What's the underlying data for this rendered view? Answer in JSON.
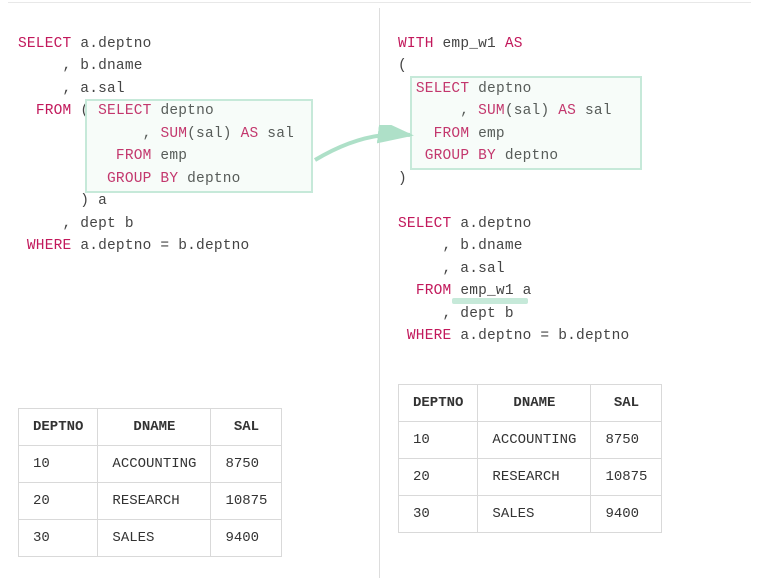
{
  "left": {
    "code": {
      "l1a": "SELECT",
      "l1b": " a.deptno",
      "l2": "     , b.dname",
      "l3": "     , a.sal",
      "l4a": "  ",
      "l4b": "FROM",
      "l4c": " ( ",
      "l4d": "SELECT",
      "l4e": " deptno",
      "l5a": "              , ",
      "l5b": "SUM",
      "l5c": "(sal) ",
      "l5d": "AS",
      "l5e": " sal",
      "l6a": "           ",
      "l6b": "FROM",
      "l6c": " emp",
      "l7a": "          ",
      "l7b": "GROUP BY",
      "l7c": " deptno",
      "l8": "       ) a",
      "l9": "     , dept b",
      "l10a": " ",
      "l10b": "WHERE",
      "l10c": " a.deptno = b.deptno"
    },
    "table": {
      "headers": [
        "DEPTNO",
        "DNAME",
        "SAL"
      ],
      "rows": [
        [
          "10",
          "ACCOUNTING",
          "8750"
        ],
        [
          "20",
          "RESEARCH",
          "10875"
        ],
        [
          "30",
          "SALES",
          "9400"
        ]
      ]
    }
  },
  "right": {
    "code": {
      "l1a": "WITH",
      "l1b": " emp_w1 ",
      "l1c": "AS",
      "l2": "(",
      "l3a": "  ",
      "l3b": "SELECT",
      "l3c": " deptno",
      "l4a": "       , ",
      "l4b": "SUM",
      "l4c": "(sal) ",
      "l4d": "AS",
      "l4e": " sal",
      "l5a": "    ",
      "l5b": "FROM",
      "l5c": " emp",
      "l6a": "   ",
      "l6b": "GROUP BY",
      "l6c": " deptno",
      "l7": ")",
      "l8": "",
      "l9a": "SELECT",
      "l9b": " a.deptno",
      "l10": "     , b.dname",
      "l11": "     , a.sal",
      "l12a": "  ",
      "l12b": "FROM",
      "l12c": " emp_w1 a",
      "l13": "     , dept b",
      "l14a": " ",
      "l14b": "WHERE",
      "l14c": " a.deptno = b.deptno"
    },
    "table": {
      "headers": [
        "DEPTNO",
        "DNAME",
        "SAL"
      ],
      "rows": [
        [
          "10",
          "ACCOUNTING",
          "8750"
        ],
        [
          "20",
          "RESEARCH",
          "10875"
        ],
        [
          "30",
          "SALES",
          "9400"
        ]
      ]
    }
  }
}
